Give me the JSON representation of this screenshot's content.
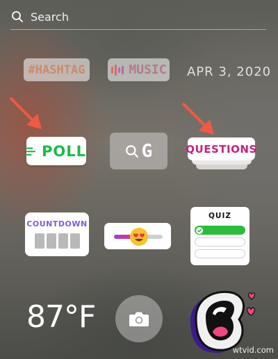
{
  "search": {
    "placeholder": "Search"
  },
  "stickers": {
    "hashtag": "#HASHTAG",
    "music": "MUSIC",
    "date": "APR 3, 2020",
    "poll": "POLL",
    "mention_glyph": "G",
    "questions": "QUESTIONS",
    "countdown": "COUNTDOWN",
    "quiz": "QUIZ",
    "temperature": "87°F"
  },
  "quiz_options": [
    "correct",
    "plain",
    "plain"
  ],
  "slider_level": 0.5,
  "icons": [
    "search-icon",
    "music-bars-icon",
    "poll-lines-icon",
    "search-glyph-icon",
    "heart-eyes-emoji-icon",
    "check-icon",
    "camera-icon",
    "arrow-icon"
  ],
  "watermark": "wtvid.com",
  "colors": {
    "poll_green": "#1fb94a",
    "questions_pink": "#c4217f",
    "countdown_purple": "#7d5cd6",
    "quiz_green": "#2dbb3c",
    "arrow": "#f05a44"
  }
}
